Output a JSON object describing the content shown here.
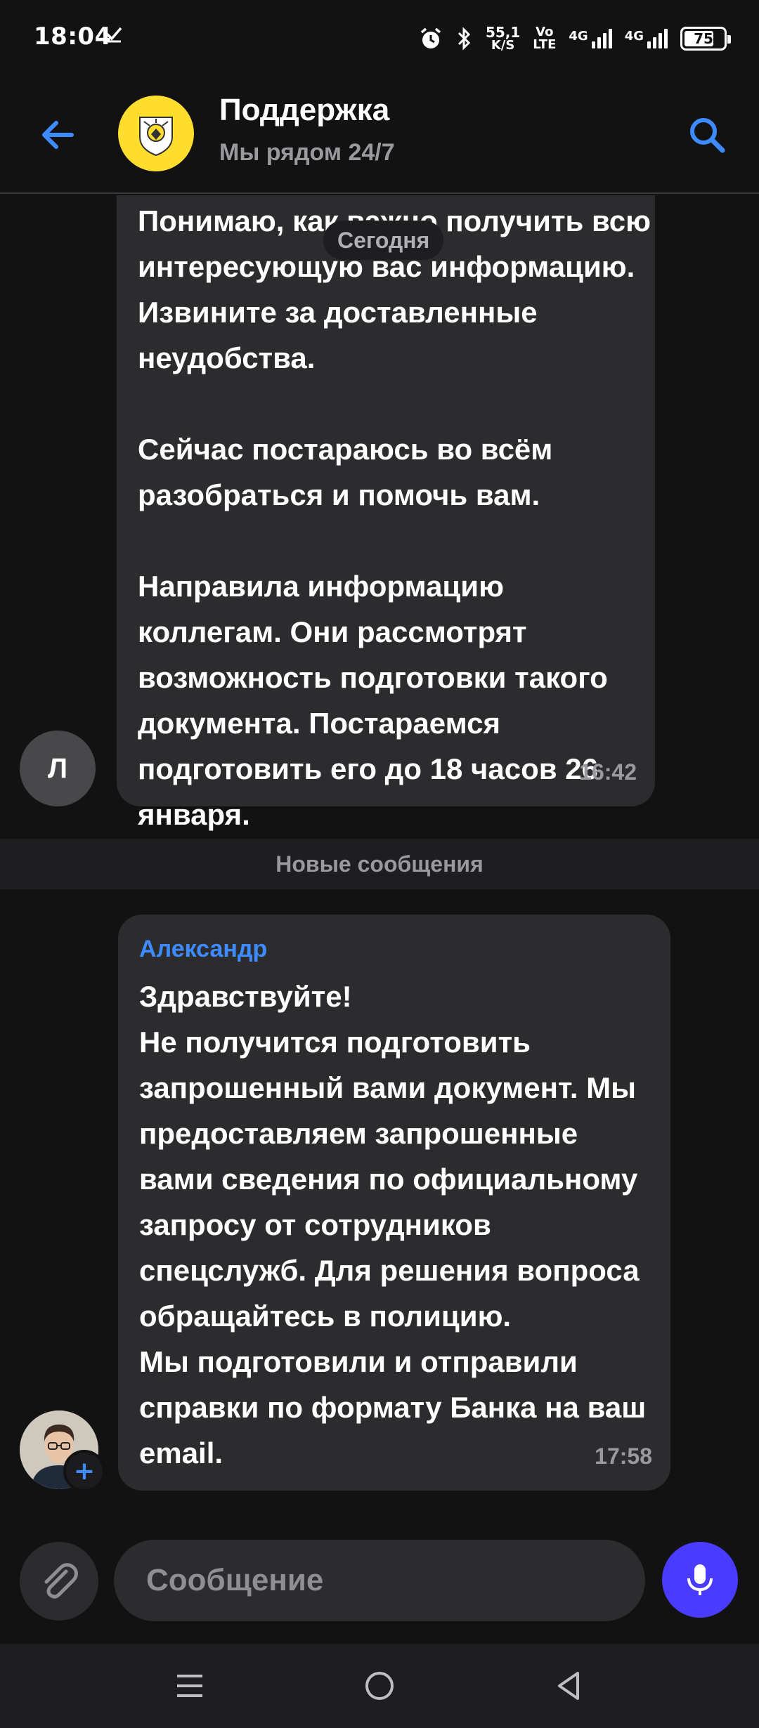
{
  "status_bar": {
    "time": "18:04",
    "speed_value": "55,1",
    "speed_unit": "K/S",
    "volte_top": "Vo",
    "volte_bottom": "LTE",
    "net1_label": "4G",
    "net2_label": "4G",
    "battery_level": "75",
    "battery_fraction": 0.75
  },
  "header": {
    "title": "Поддержка",
    "subtitle": "Мы рядом 24/7"
  },
  "chat": {
    "date_label": "Сегодня",
    "messages": [
      {
        "sender_initial": "Л",
        "text": "Понимаю, как важно получить всю интересующую вас информацию. Извините за доставленные неудобства.\n\nСейчас постараюсь во всём разобраться и помочь вам.\n\nНаправила информацию коллегам. Они рассмотрят возможность подготовки такого документа. Постараемся подготовить его до 18 часов 26 января.",
        "time": "16:42"
      },
      {
        "sender_name": "Александр",
        "text": "Здравствуйте!\nНе получится подготовить запрошенный вами документ. Мы предоставляем запрошенные вами сведения по официальному запросу от сотрудников спецслужб. Для решения вопроса обращайтесь в полицию.\nМы подготовили и отправили справки по формату Банка на ваш email.",
        "time": "17:58"
      }
    ],
    "new_messages_label": "Новые сообщения"
  },
  "composer": {
    "placeholder": "Сообщение"
  },
  "colors": {
    "background": "#121212",
    "bubble": "#2c2c2e",
    "accent_blue": "#3d8bff",
    "mic_button": "#4a3cff",
    "logo_yellow": "#ffdd2d"
  },
  "icons": {
    "back": "arrow-left-icon",
    "search": "search-icon",
    "attach": "paperclip-icon",
    "mic": "microphone-icon",
    "nav_menu": "menu-icon",
    "nav_home": "home-circle-icon",
    "nav_back": "triangle-back-icon"
  }
}
